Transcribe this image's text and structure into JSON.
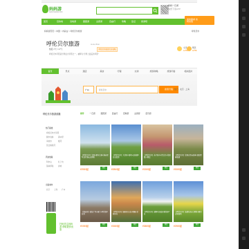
{
  "header": {
    "logo_text": "妈妈游",
    "logo_accent": "游",
    "site_url": "www.maoetu.com",
    "search_placeholder": "",
    "app_text": "妈妈一日游",
    "app_sub": "免费下载APP"
  },
  "nav": {
    "items": [
      "首页",
      "目的地",
      "当地游",
      "跟团游",
      "主题游",
      "自由行",
      "攻略",
      "签证",
      "旅游吧"
    ],
    "cta": "发布需求 省时省钱"
  },
  "breadcrumb": {
    "items": [
      "妈妈游首页",
      "中国",
      "内蒙古",
      "呼伦贝尔旅游"
    ],
    "right": "呼伦贝尔"
  },
  "destination": {
    "title": "呼伦贝尔旅游",
    "title_en": "HulunBuir",
    "badge": "呼伦贝尔旅游完全攻略",
    "stats": "热度 2℃～17℃",
    "desc": "呼伦贝尔草原是世界四大草原之一，被称为“世界上最美的草原”"
  },
  "weather": {
    "today_label": "今天",
    "today_value": "14℃",
    "tomorrow_label": "明天",
    "tomorrow_value": "16℃"
  },
  "tabs": [
    "首页",
    "景点",
    "酒店",
    "美食",
    "行程",
    "交通",
    "旅游攻略",
    "旅游问答",
    "相关图片"
  ],
  "search_banner": {
    "city": "广州",
    "destination_placeholder": "呼伦贝尔",
    "button": "搜索行程",
    "links": "热门 · 北京 · 上海"
  },
  "sidebar": {
    "section_title": "呼伦贝尔旅游线路",
    "groups": [
      {
        "title": "热门路线",
        "items": [
          "呼伦贝尔大草原",
          "额尔古纳",
          "满洲里",
          "海拉尔",
          "根河",
          "莫日格勒河"
        ]
      },
      {
        "title": "周边线路",
        "items": [
          "阿尔山",
          "扎兰屯",
          "锡林郭勒",
          "赤峰"
        ]
      },
      {
        "title": "出发城市",
        "items": [
          "北京",
          "上海",
          "广州"
        ]
      }
    ],
    "qr_text": "扫码关注妈妈游 获取更多优惠"
  },
  "filters": [
    "推荐",
    "一日游",
    "跟团游",
    "自由行",
    "定制游",
    "主题游",
    "自驾游"
  ],
  "products": [
    {
      "caption": "【呼伦贝尔】草原+额尔古纳+满洲里5日游 纯玩无购物",
      "price": "¥2980起",
      "button": "预定"
    },
    {
      "caption": "【呼伦贝尔】大草原+湿地+边境线6日深度游",
      "price": "¥2860起",
      "button": "预定"
    },
    {
      "caption": "【呼伦贝尔】亲子骑马+蒙古包+草原篝火晚会",
      "price": "¥3280起",
      "button": "预定"
    },
    {
      "caption": "【呼伦贝尔】草原自驾+森林+湖泊经典路线",
      "price": "¥3080起",
      "button": "预定"
    },
    {
      "caption": "【满洲里】套娃广场+国门+呼伦湖4日游",
      "price": "¥1980起",
      "button": "预定"
    },
    {
      "caption": "【呼伦贝尔】摄影团 日出+晚霞+草原风光",
      "price": "¥2680起",
      "button": "预定"
    },
    {
      "caption": "【呼伦贝尔】越野车深度穿越草原7日",
      "price": "¥3880起",
      "button": "预定"
    },
    {
      "caption": "【呼伦贝尔】油菜花海+白桦林+额尔古纳湿地",
      "price": "¥2980起",
      "button": "预定"
    }
  ],
  "colors": {
    "brand": "#62c02e",
    "accent": "#ff8a00",
    "price": "#ff6a00"
  }
}
